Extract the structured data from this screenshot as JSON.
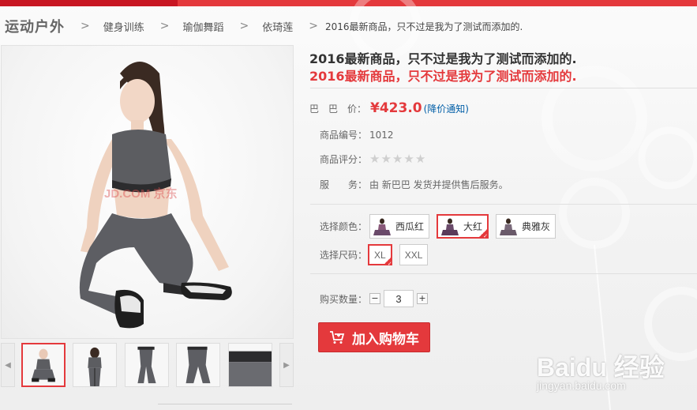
{
  "breadcrumb": {
    "root": "运动户外",
    "items": [
      "健身训练",
      "瑜伽舞蹈",
      "依琦莲",
      "2016最新商品，只不过是我为了测试而添加的."
    ],
    "separator": ">"
  },
  "product": {
    "title": "2016最新商品，只不过是我为了测试而添加的.",
    "subtitle": "2016最新商品，只不过是我为了测试而添加的.",
    "price_label": "巴　巴　价：",
    "price": "¥423.0",
    "price_notice": "(降价通知)",
    "sku_label": "商品编号：",
    "sku": "1012",
    "rating_label": "商品评分：",
    "rating": 0,
    "rating_max": 5,
    "service_label": "服　　务：",
    "service": "由 新巴巴 发货并提供售后服务。",
    "image_watermark": "JD.COM 京东"
  },
  "options": {
    "color_label": "选择颜色：",
    "colors": [
      "西瓜红",
      "大红",
      "典雅灰"
    ],
    "selected_color": "大红",
    "size_label": "选择尺码：",
    "sizes": [
      "XL",
      "XXL"
    ],
    "selected_size": "XL"
  },
  "quantity": {
    "label": "购买数量：",
    "minus": "−",
    "value": "3",
    "plus": "+"
  },
  "cart_button": {
    "label": "加入购物车",
    "icon": "cart-plus-icon"
  },
  "thumbnails": {
    "count": 5,
    "selected_index": 0,
    "prev_icon": "chevron-left-icon",
    "next_icon": "chevron-right-icon"
  },
  "watermark": {
    "brand": "Baidu 经验",
    "url": "jingyan.baidu.com"
  },
  "colors": {
    "accent": "#e4393c",
    "accent_dark": "#c81623",
    "link": "#005ea7"
  }
}
